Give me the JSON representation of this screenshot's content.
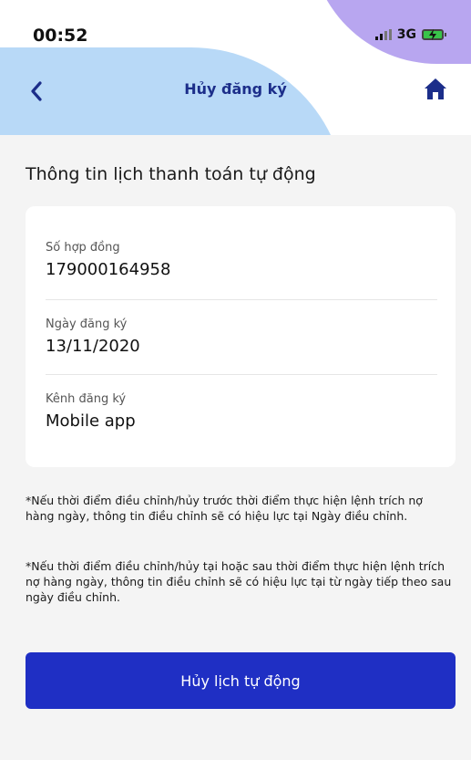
{
  "status_bar": {
    "time": "00:52",
    "network": "3G"
  },
  "nav": {
    "title": "Hủy đăng ký"
  },
  "section_title": "Thông tin lịch thanh toán tự động",
  "card": {
    "fields": [
      {
        "label": "Số hợp đồng",
        "value": "179000164958"
      },
      {
        "label": "Ngày đăng ký",
        "value": "13/11/2020"
      },
      {
        "label": "Kênh đăng ký",
        "value": "Mobile app"
      }
    ]
  },
  "notes": [
    "*Nếu thời điểm điều chỉnh/hủy trước thời điểm thực hiện lệnh trích nợ hàng ngày, thông tin điều chỉnh sẽ có hiệu lực tại Ngày điều chỉnh.",
    "*Nếu thời điểm điều chỉnh/hủy tại hoặc sau thời điểm thực hiện lệnh trích nợ hàng ngày, thông tin điều chỉnh sẽ có hiệu lực tại từ ngày tiếp theo sau ngày điều chỉnh."
  ],
  "actions": {
    "cancel_label": "Hủy lịch tự động"
  },
  "colors": {
    "primary": "#1f2fc4",
    "title_text": "#1c2e8a",
    "header_blue": "#b8d9f7",
    "header_purple": "#b8a6f0",
    "battery": "#39c44a"
  },
  "icons": {
    "back": "chevron-left-icon",
    "home": "home-icon",
    "signal": "signal-icon",
    "battery": "battery-charging-icon"
  }
}
